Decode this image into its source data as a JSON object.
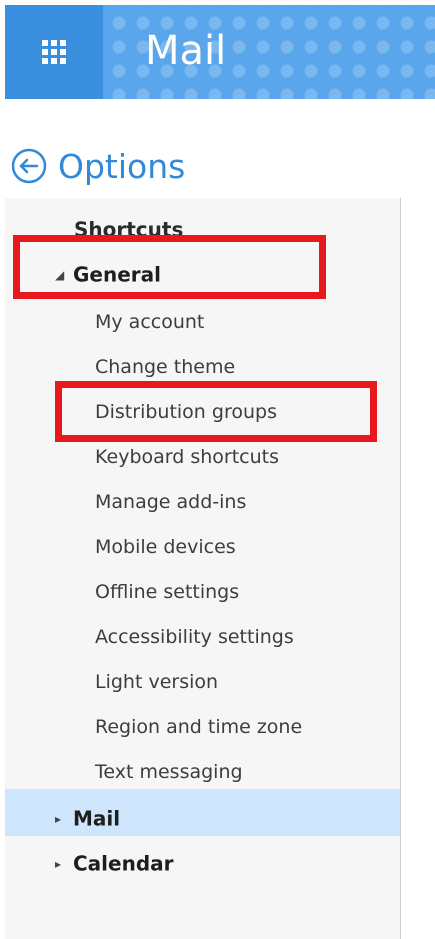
{
  "header": {
    "app_title": "Mail",
    "waffle_icon": "app-launcher-icon",
    "background_color": "#59a6ec"
  },
  "options": {
    "back_icon": "back-arrow-circle-icon",
    "label": "Options",
    "accent_color": "#3389d9"
  },
  "nav": {
    "shortcuts": "Shortcuts",
    "general": {
      "label": "General",
      "expanded": true,
      "items": [
        "My account",
        "Change theme",
        "Distribution groups",
        "Keyboard shortcuts",
        "Manage add-ins",
        "Mobile devices",
        "Offline settings",
        "Accessibility settings",
        "Light version",
        "Region and time zone",
        "Text messaging"
      ]
    },
    "mail": {
      "label": "Mail",
      "expanded": false,
      "selected": true
    },
    "calendar": {
      "label": "Calendar",
      "expanded": false
    }
  },
  "highlight": {
    "annotation_color": "#e8191e",
    "selected_row_color": "#cfe5fb"
  }
}
